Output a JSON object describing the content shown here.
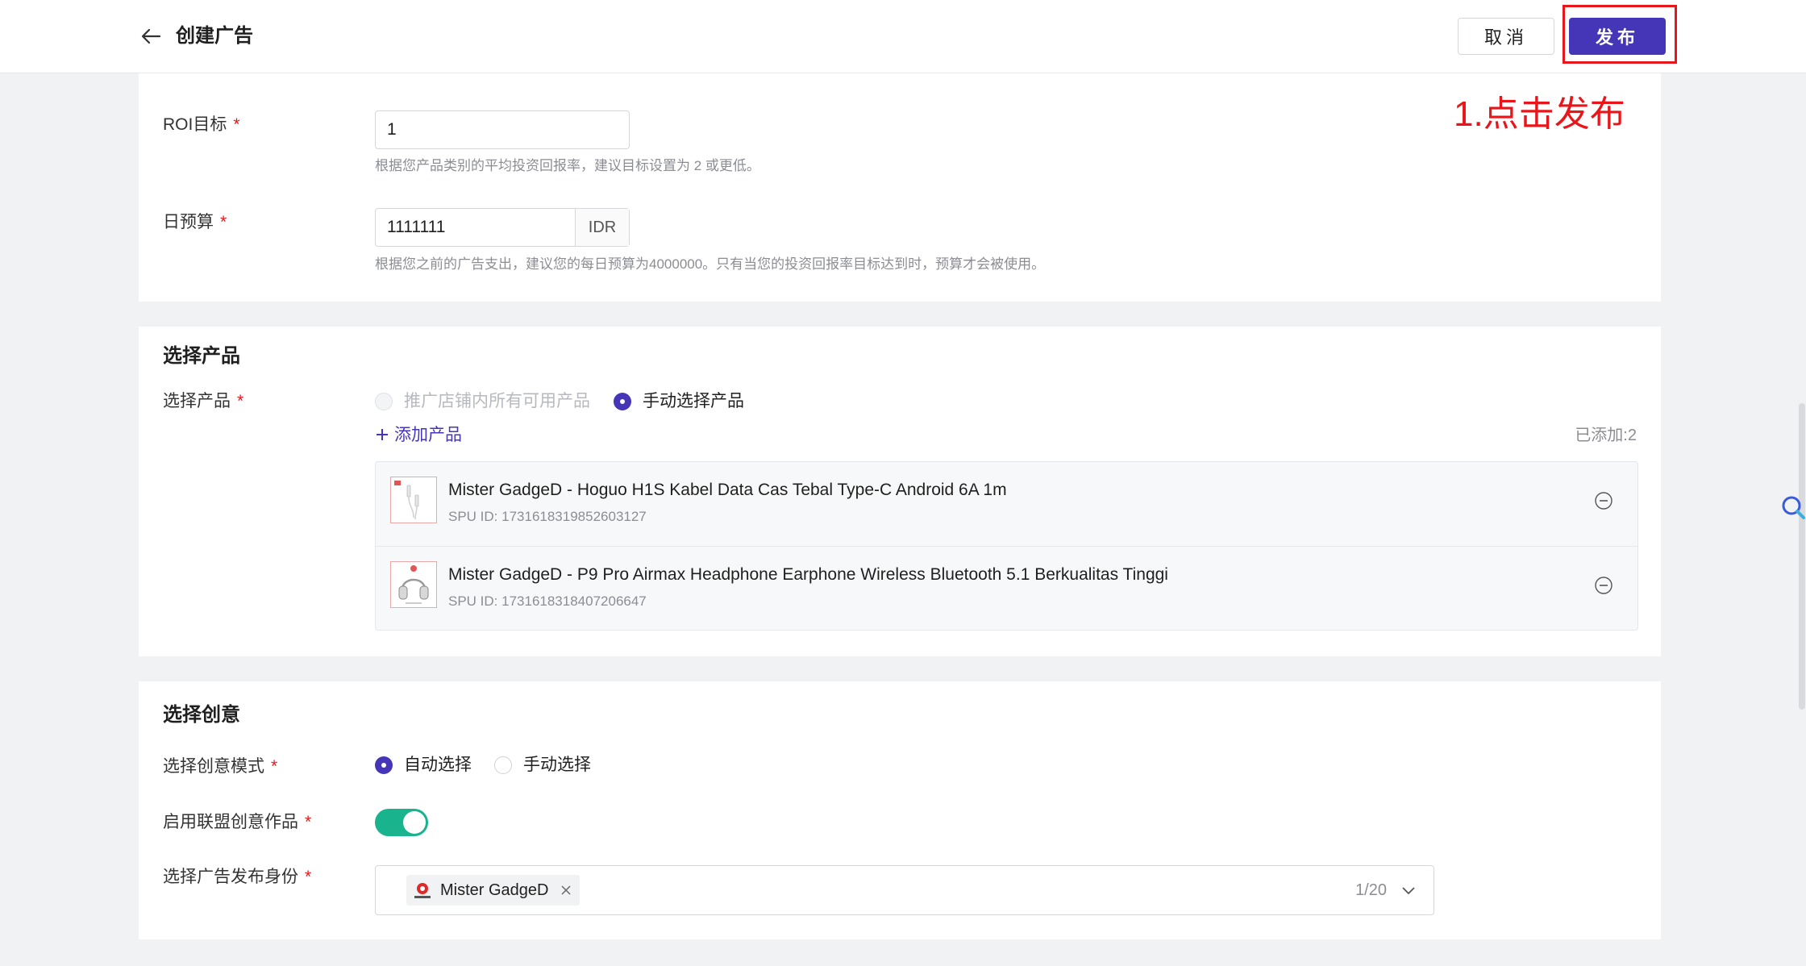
{
  "header": {
    "title": "创建广告",
    "cancel_label": "取消",
    "publish_label": "发布"
  },
  "annotation": "1.点击发布",
  "roi": {
    "label": "ROI目标",
    "value": "1",
    "hint": "根据您产品类别的平均投资回报率，建议目标设置为 2 或更低。"
  },
  "budget": {
    "label": "日预算",
    "value": "1111111",
    "currency": "IDR",
    "hint": "根据您之前的广告支出，建议您的每日预算为4000000。只有当您的投资回报率目标达到时，预算才会被使用。"
  },
  "products": {
    "section_title": "选择产品",
    "field_label": "选择产品",
    "option_all": "推广店铺内所有可用产品",
    "option_manual": "手动选择产品",
    "add_label": "添加产品",
    "added_count": "已添加:2",
    "items": [
      {
        "title": "Mister GadgeD - Hoguo H1S Kabel Data Cas Tebal Type-C Android 6A 1m",
        "spu": "SPU ID: 1731618319852603127"
      },
      {
        "title": "Mister GadgeD - P9 Pro Airmax Headphone Earphone Wireless Bluetooth 5.1 Berkualitas Tinggi",
        "spu": "SPU ID: 1731618318407206647"
      }
    ]
  },
  "creative": {
    "section_title": "选择创意",
    "mode_label": "选择创意模式",
    "mode_auto": "自动选择",
    "mode_manual": "手动选择",
    "affiliate_label": "启用联盟创意作品",
    "affiliate_enabled": true,
    "identity_label": "选择广告发布身份",
    "identity_tag": "Mister GadgeD",
    "identity_count": "1/20"
  },
  "colors": {
    "primary": "#4436b7",
    "annotation_red": "#e8161a",
    "switch_on": "#19b38d"
  }
}
